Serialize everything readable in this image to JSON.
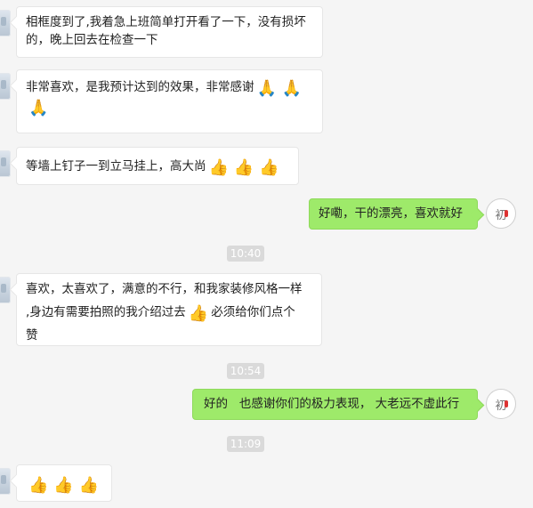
{
  "messages": [
    {
      "side": "left",
      "lines": [
        "相框度到了,我着急上班简单打开看了一下，没有损坏",
        "的，晚上回去在检查一下"
      ]
    },
    {
      "side": "left",
      "text": "非常喜欢，是我预计达到的效果，非常感谢",
      "emoji": "🙏"
    },
    {
      "side": "left",
      "text": "等墙上钉子一到立马挂上，高大尚",
      "emoji": "👍"
    },
    {
      "side": "right",
      "text": "好嘞，干的漂亮，喜欢就好"
    },
    {
      "side": "left",
      "lines": [
        "喜欢，太喜欢了，满意的不行，和我家装修风格一样",
        ",身边有需要拍照的我介绍过去",
        "必须给你们点个",
        "赞"
      ],
      "emoji": "👍"
    },
    {
      "side": "right",
      "text": "好的   也感谢你们的极力表现， 大老远不虚此行"
    },
    {
      "side": "left",
      "emoji": "👍"
    }
  ],
  "timestamps": [
    "10:40",
    "10:54",
    "11:09"
  ],
  "avatar_right_text": "初"
}
